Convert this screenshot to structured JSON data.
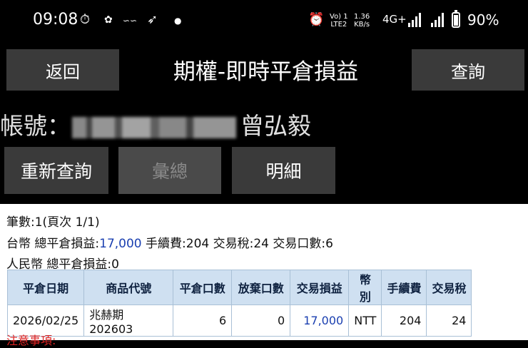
{
  "status_bar": {
    "time": "09:08",
    "speed_value": "1.36",
    "speed_unit": "KB/s",
    "volte_top": "Vo) 1",
    "volte_bottom": "LTE2",
    "network": "4G+",
    "battery": "90%"
  },
  "header": {
    "back_label": "返回",
    "title": "期權-即時平倉損益",
    "query_label": "查詢"
  },
  "account": {
    "label": "帳號：",
    "name": "曾弘毅"
  },
  "actions": {
    "refresh_label": "重新查詢",
    "summary_label": "彙總",
    "detail_label": "明細"
  },
  "summary": {
    "count_line": "筆數:1(頁次 1/1)",
    "twd_prefix": "台幣 總平倉損益:",
    "twd_pl": "17,000",
    "twd_rest": " 手續費:204 交易稅:24 交易口數:6",
    "rmb_line": "人民幣 總平倉損益:0"
  },
  "table": {
    "headers": [
      "平倉日期",
      "商品代號",
      "平倉口數",
      "放棄口數",
      "交易損益",
      "幣別",
      "手續費",
      "交易稅"
    ],
    "rows": [
      [
        "2026/02/25",
        "兆赫期 202603",
        "6",
        "0",
        "17,000",
        "NTT",
        "204",
        "24"
      ]
    ]
  },
  "note": "注意事項:"
}
